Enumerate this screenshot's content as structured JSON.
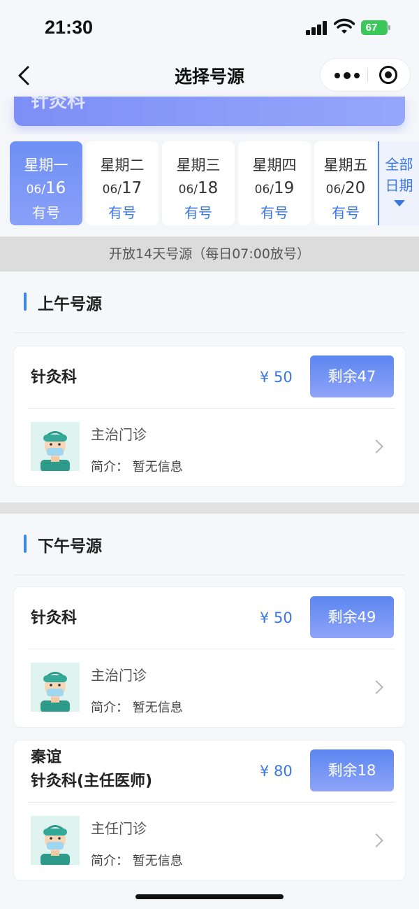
{
  "status_bar": {
    "time": "21:30",
    "battery": "67"
  },
  "nav": {
    "title": "选择号源"
  },
  "banner": {
    "dept": "针灸科"
  },
  "dates": [
    {
      "weekday": "星期一",
      "month": "06/",
      "day": "16",
      "status": "有号",
      "active": true
    },
    {
      "weekday": "星期二",
      "month": "06/",
      "day": "17",
      "status": "有号",
      "active": false
    },
    {
      "weekday": "星期三",
      "month": "06/",
      "day": "18",
      "status": "有号",
      "active": false
    },
    {
      "weekday": "星期四",
      "month": "06/",
      "day": "19",
      "status": "有号",
      "active": false
    },
    {
      "weekday": "星期五",
      "month": "06/",
      "day": "20",
      "status": "有号",
      "active": false
    }
  ],
  "all_dates_label": "全部日期",
  "notice": "开放14天号源（每日07:00放号）",
  "morning": {
    "title": "上午号源",
    "slots": [
      {
        "dept": "针灸科",
        "price": "¥ 50",
        "remaining": "剩余47",
        "level": "主治门诊",
        "intro": "简介：  暂无信息"
      }
    ]
  },
  "afternoon": {
    "title": "下午号源",
    "slots": [
      {
        "dept": "针灸科",
        "price": "¥ 50",
        "remaining": "剩余49",
        "level": "主治门诊",
        "intro": "简介：  暂无信息"
      },
      {
        "doctor": "秦谊",
        "dept": "针灸科(主任医师)",
        "price": "¥ 80",
        "remaining": "剩余18",
        "level": "主任门诊",
        "intro": "简介：  暂无信息"
      }
    ]
  },
  "colors": {
    "accent": "#3b76e0",
    "button_gradient_top": "#5b86f0",
    "button_gradient_bottom": "#8fa4f8"
  },
  "icons": [
    "back-arrow-icon",
    "more-dots-icon",
    "close-target-icon",
    "dropdown-arrow-icon",
    "chevron-right-icon",
    "doctor-avatar-icon"
  ]
}
